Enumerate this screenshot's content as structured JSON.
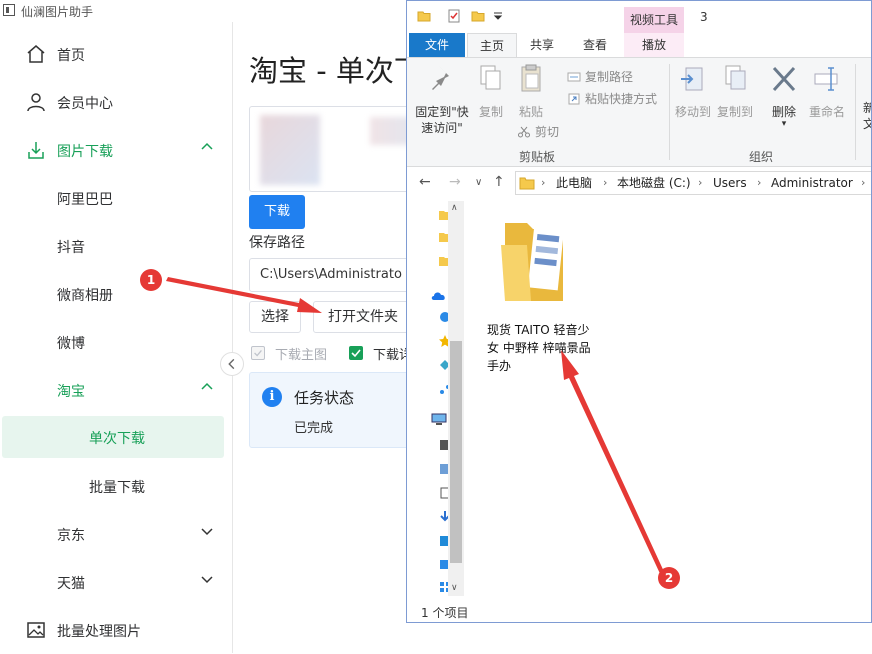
{
  "app": {
    "title": "仙澜图片助手"
  },
  "sidebar": {
    "items": [
      {
        "label": "首页",
        "icon": "home-icon"
      },
      {
        "label": "会员中心",
        "icon": "user-icon"
      },
      {
        "label": "图片下载",
        "icon": "download-icon"
      },
      {
        "label": "阿里巴巴"
      },
      {
        "label": "抖音"
      },
      {
        "label": "微商相册"
      },
      {
        "label": "微博"
      },
      {
        "label": "淘宝"
      },
      {
        "label": "单次下载"
      },
      {
        "label": "批量下载"
      },
      {
        "label": "京东"
      },
      {
        "label": "天猫"
      },
      {
        "label": "批量处理图片",
        "icon": "image-icon"
      }
    ],
    "accent": "#18a058"
  },
  "main": {
    "title": "淘宝 - 单次下",
    "download_button": "下载",
    "save_path_label": "保存路径",
    "save_path_value": "C:\\Users\\Administrato",
    "select_button": "选择",
    "open_folder_button": "打开文件夹",
    "checkbox_main": "下载主图",
    "checkbox_detail": "下载详",
    "status_title": "任务状态",
    "status_value": "已完成"
  },
  "explorer": {
    "window_number": "3",
    "video_tools": "视频工具",
    "tabs": [
      "文件",
      "主页",
      "共享",
      "查看",
      "播放"
    ],
    "ribbon": {
      "pin": "固定到\"快速访问\"",
      "copy": "复制",
      "paste": "粘贴",
      "copy_path": "复制路径",
      "paste_shortcut": "粘贴快捷方式",
      "cut": "剪切",
      "clipboard_group": "剪贴板",
      "move_to": "移动到",
      "copy_to": "复制到",
      "delete": "删除",
      "rename": "重命名",
      "organize_group": "组织",
      "new_partial": "新",
      "new_partial2": "文"
    },
    "breadcrumb": [
      "此电脑",
      "本地磁盘 (C:)",
      "Users",
      "Administrator"
    ],
    "folder_name": "现货 TAITO 轻音少女 中野梓 梓喵景品手办",
    "status": "1 个项目"
  },
  "annotations": {
    "badge1": "1",
    "badge2": "2",
    "color": "#e53935"
  }
}
